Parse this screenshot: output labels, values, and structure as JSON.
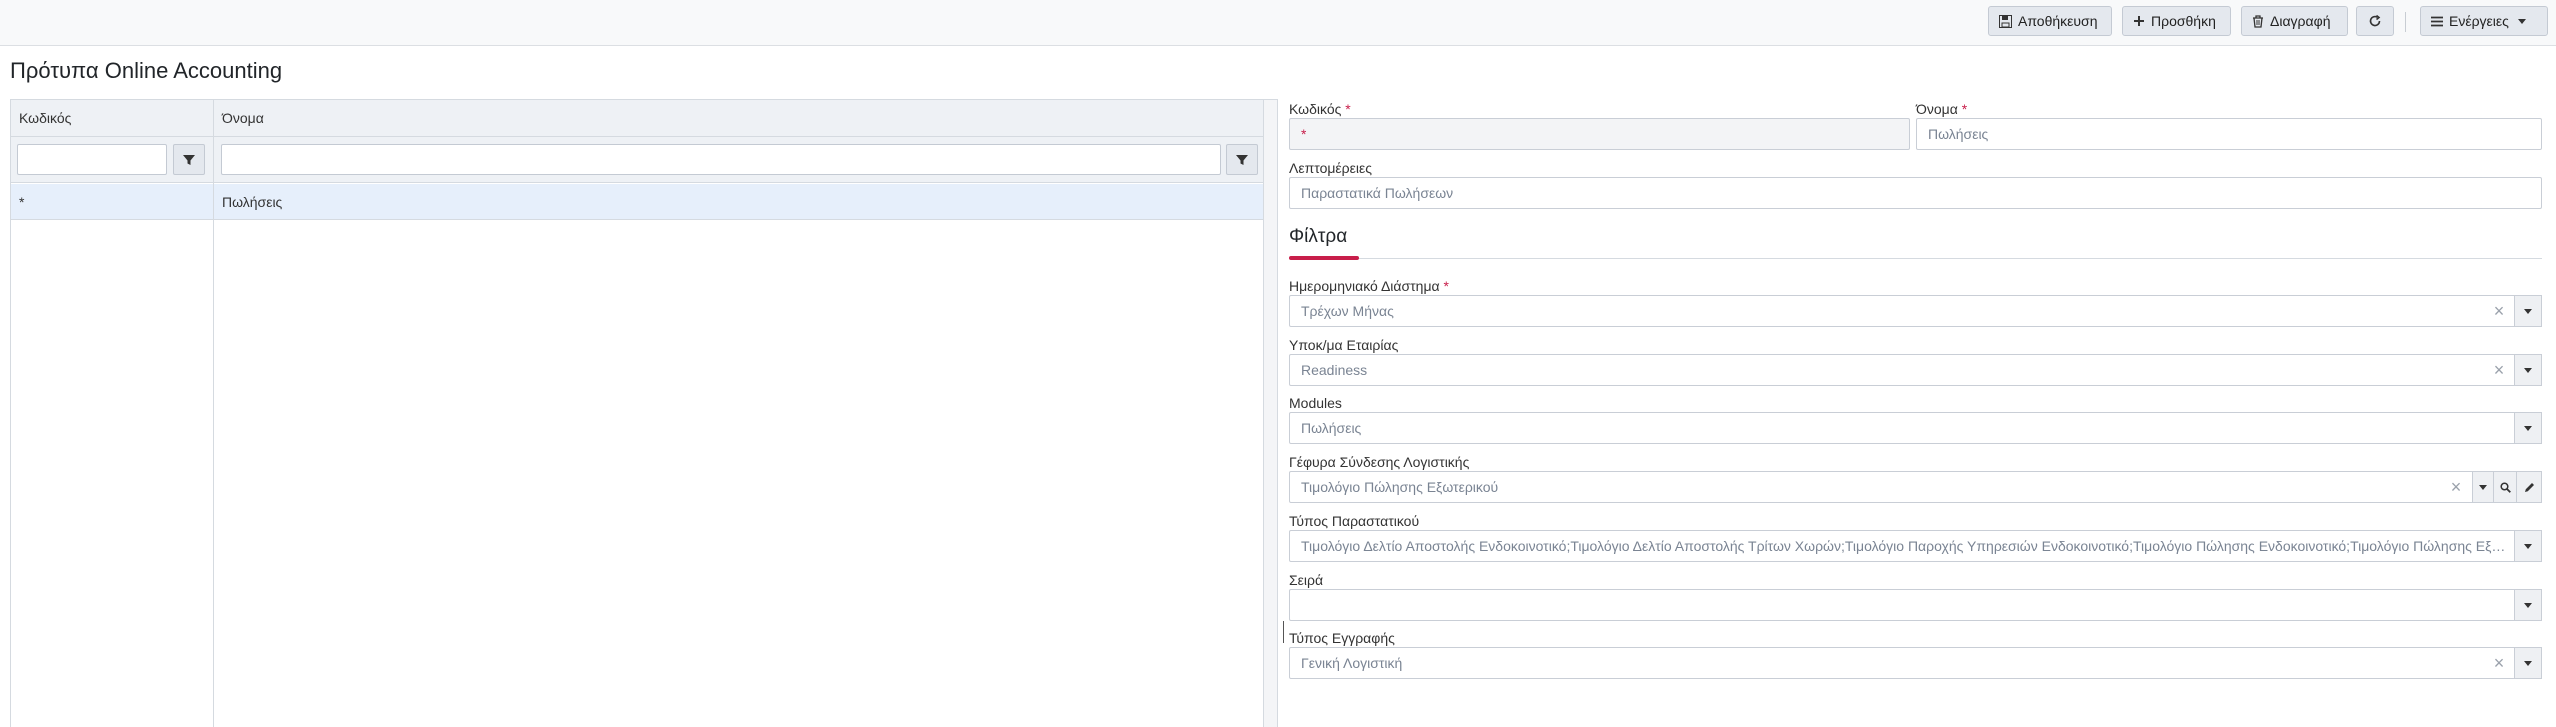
{
  "toolbar": {
    "save_label": "Αποθήκευση",
    "add_label": "Προσθήκη",
    "delete_label": "Διαγραφή",
    "actions_label": "Ενέργειες"
  },
  "page": {
    "title": "Πρότυπα Online Accounting"
  },
  "grid": {
    "columns": [
      {
        "label": "Κωδικός"
      },
      {
        "label": "Όνομα"
      }
    ],
    "filters": {
      "code_value": "",
      "name_value": ""
    },
    "rows": [
      {
        "code": "*",
        "name": "Πωλήσεις"
      }
    ]
  },
  "form": {
    "code": {
      "label": "Κωδικός",
      "required_mark": "*",
      "value": "*"
    },
    "name": {
      "label": "Όνομα",
      "required_mark": "*",
      "value": "Πωλήσεις"
    },
    "details": {
      "label": "Λεπτομέρειες",
      "value": "Παραστατικά Πωλήσεων"
    },
    "filters_section": {
      "title": "Φίλτρα"
    },
    "date_range": {
      "label": "Ημερομηνιακό Διάστημα",
      "required_mark": "*",
      "value": "Τρέχων Μήνας"
    },
    "company_branch": {
      "label": "Υποκ/μα Εταιρίας",
      "value": "Readiness"
    },
    "modules": {
      "label": "Modules",
      "value": "Πωλήσεις"
    },
    "accounting_bridge": {
      "label": "Γέφυρα Σύνδεσης Λογιστικής",
      "value": "Τιμολόγιο Πώλησης Εξωτερικού"
    },
    "document_type": {
      "label": "Τύπος Παραστατικού",
      "value": "Τιμολόγιο Δελτίο Αποστολής Ενδοκοινοτικό;Τιμολόγιο Δελτίο Αποστολής Τρίτων Χωρών;Τιμολόγιο Παροχής Υπηρεσιών Ενδοκοινοτικό;Τιμολόγιο Πώλησης Ενδοκοινοτικό;Τιμολόγιο Πώλησης Εξωτερικού"
    },
    "series": {
      "label": "Σειρά",
      "value": ""
    },
    "entry_type": {
      "label": "Τύπος Εγγραφής",
      "value": "Γενική Λογιστική"
    }
  },
  "colors": {
    "accent": "#c81e4a",
    "row_selected": "#e6effb",
    "button_bg": "#e4e8ee"
  }
}
